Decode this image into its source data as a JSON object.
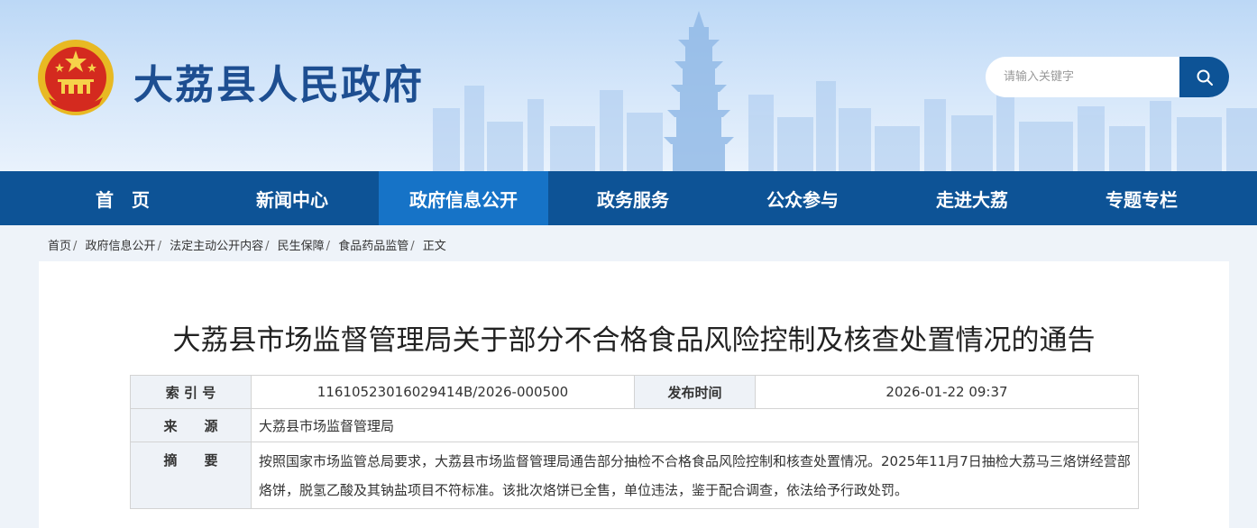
{
  "header": {
    "site_title": "大荔县人民政府",
    "search_placeholder": "请输入关键字"
  },
  "nav": {
    "items": [
      {
        "label": "首　页"
      },
      {
        "label": "新闻中心"
      },
      {
        "label": "政府信息公开"
      },
      {
        "label": "政务服务"
      },
      {
        "label": "公众参与"
      },
      {
        "label": "走进大荔"
      },
      {
        "label": "专题专栏"
      }
    ],
    "active_index": 2
  },
  "breadcrumb": {
    "items": [
      "首页",
      "政府信息公开",
      "法定主动公开内容",
      "民生保障",
      "食品药品监管",
      "正文"
    ]
  },
  "article": {
    "title": "大荔县市场监督管理局关于部分不合格食品风险控制及核查处置情况的通告",
    "index_label": "索 引 号",
    "index_value": "11610523016029414B/2026-000500",
    "date_label": "发布时间",
    "date_value": "2026-01-22 09:37",
    "source_label": "来　　源",
    "source_value": "大荔县市场监督管理局",
    "summary_label": "摘　　要",
    "summary_value": "按照国家市场监管总局要求，大荔县市场监督管理局通告部分抽检不合格食品风险控制和核查处置情况。2025年11月7日抽检大荔马三烙饼经营部烙饼，脱氢乙酸及其钠盐项目不符标准。该批次烙饼已全售，单位违法，鉴于配合调查，依法给予行政处罚。"
  },
  "colors": {
    "nav_bg": "#0d5396",
    "nav_active": "#1673c7",
    "title_blue": "#1d4e91"
  }
}
